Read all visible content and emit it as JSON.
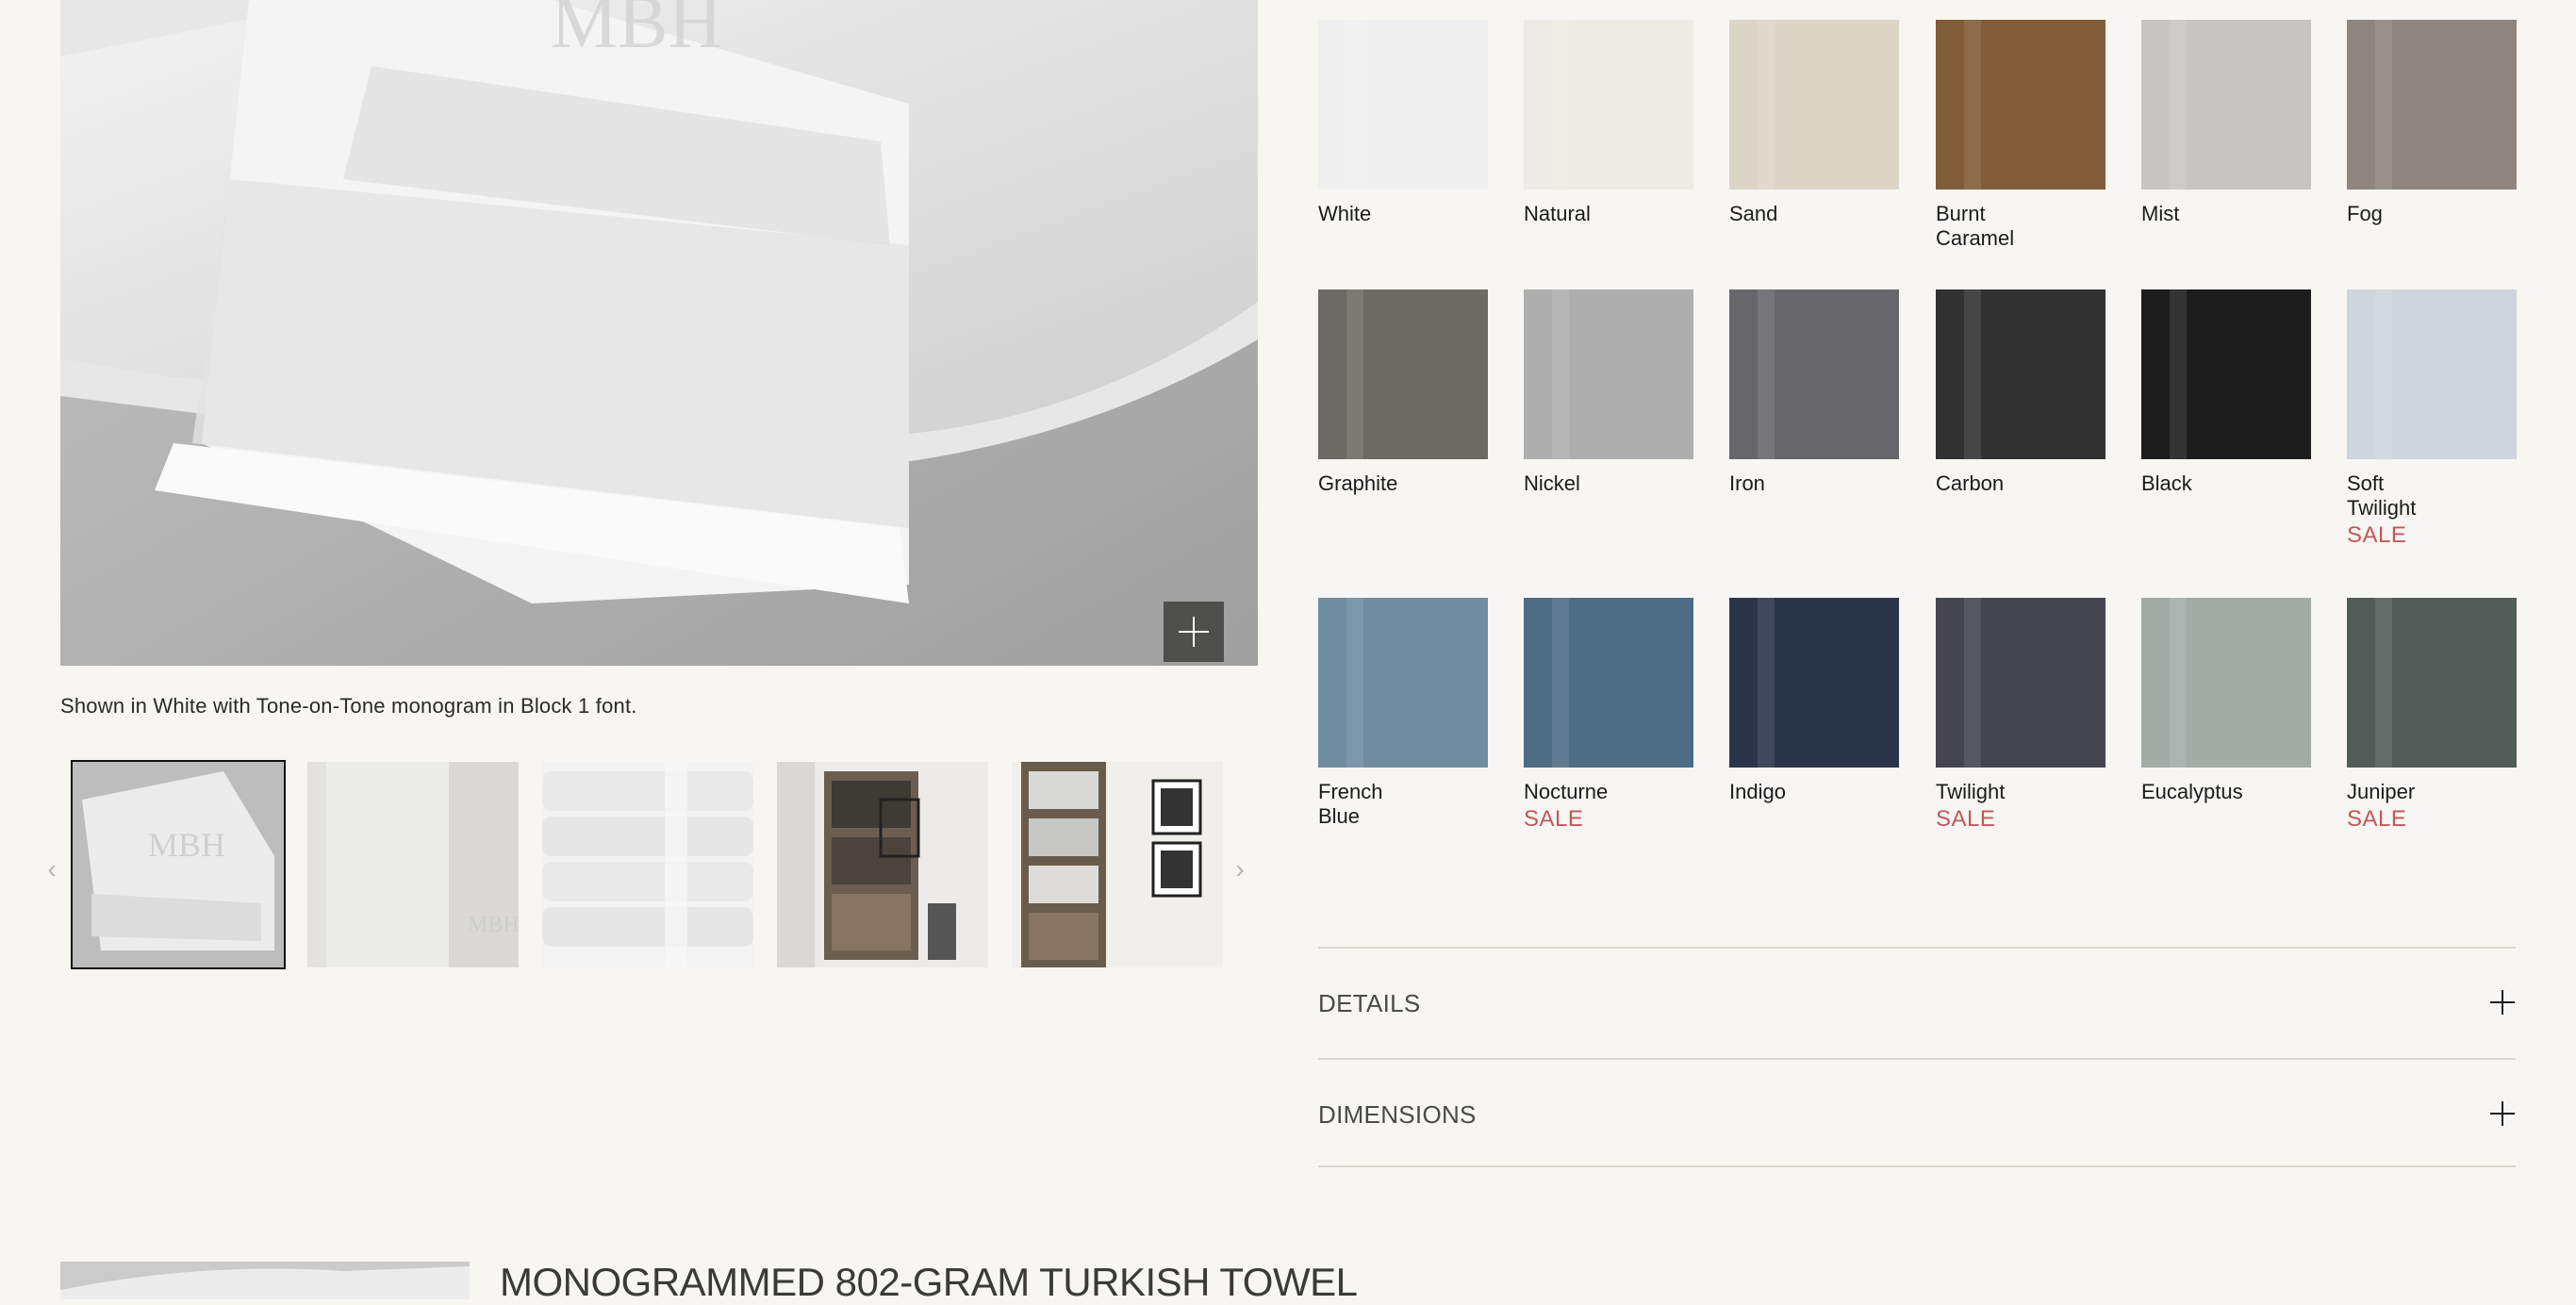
{
  "gallery": {
    "caption": "Shown in White with Tone-on-Tone monogram in Block 1 font.",
    "thumbnails": [
      "monogrammed-towel-stack",
      "hanging-towel-monogram",
      "folded-towel-stack",
      "bathroom-shelf-scene",
      "bookshelf-towel-scene"
    ]
  },
  "swatches": [
    {
      "name": "White",
      "color": "#f0f0f0"
    },
    {
      "name": "Natural",
      "color": "#ecebe4"
    },
    {
      "name": "Sand",
      "color": "#ddd6c7"
    },
    {
      "name": "Burnt Caramel",
      "color": "#805c38"
    },
    {
      "name": "Mist",
      "color": "#c8c6c3"
    },
    {
      "name": "Fog",
      "color": "#8e857e"
    },
    {
      "name": "Graphite",
      "color": "#6d6a65"
    },
    {
      "name": "Nickel",
      "color": "#aeaeae"
    },
    {
      "name": "Iron",
      "color": "#67676b"
    },
    {
      "name": "Carbon",
      "color": "#313131"
    },
    {
      "name": "Black",
      "color": "#1d1d1d"
    },
    {
      "name": "Soft Twilight",
      "color": "#cfd5dc",
      "sale": "SALE"
    },
    {
      "name": "French Blue",
      "color": "#6f8da1"
    },
    {
      "name": "Nocturne",
      "color": "#4d6c85",
      "sale": "SALE"
    },
    {
      "name": "Indigo",
      "color": "#2b354a"
    },
    {
      "name": "Twilight",
      "color": "#444551",
      "sale": "SALE"
    },
    {
      "name": "Eucalyptus",
      "color": "#a3aba7"
    },
    {
      "name": "Juniper",
      "color": "#515c58",
      "sale": "SALE"
    }
  ],
  "accordion": [
    {
      "label": "DETAILS"
    },
    {
      "label": "DIMENSIONS"
    }
  ],
  "related": {
    "title": "MONOGRAMMED 802-GRAM TURKISH TOWEL"
  },
  "colors": {
    "background": "#f7f6f3",
    "sale": "#c2585a",
    "divider": "#d9d7d2"
  }
}
